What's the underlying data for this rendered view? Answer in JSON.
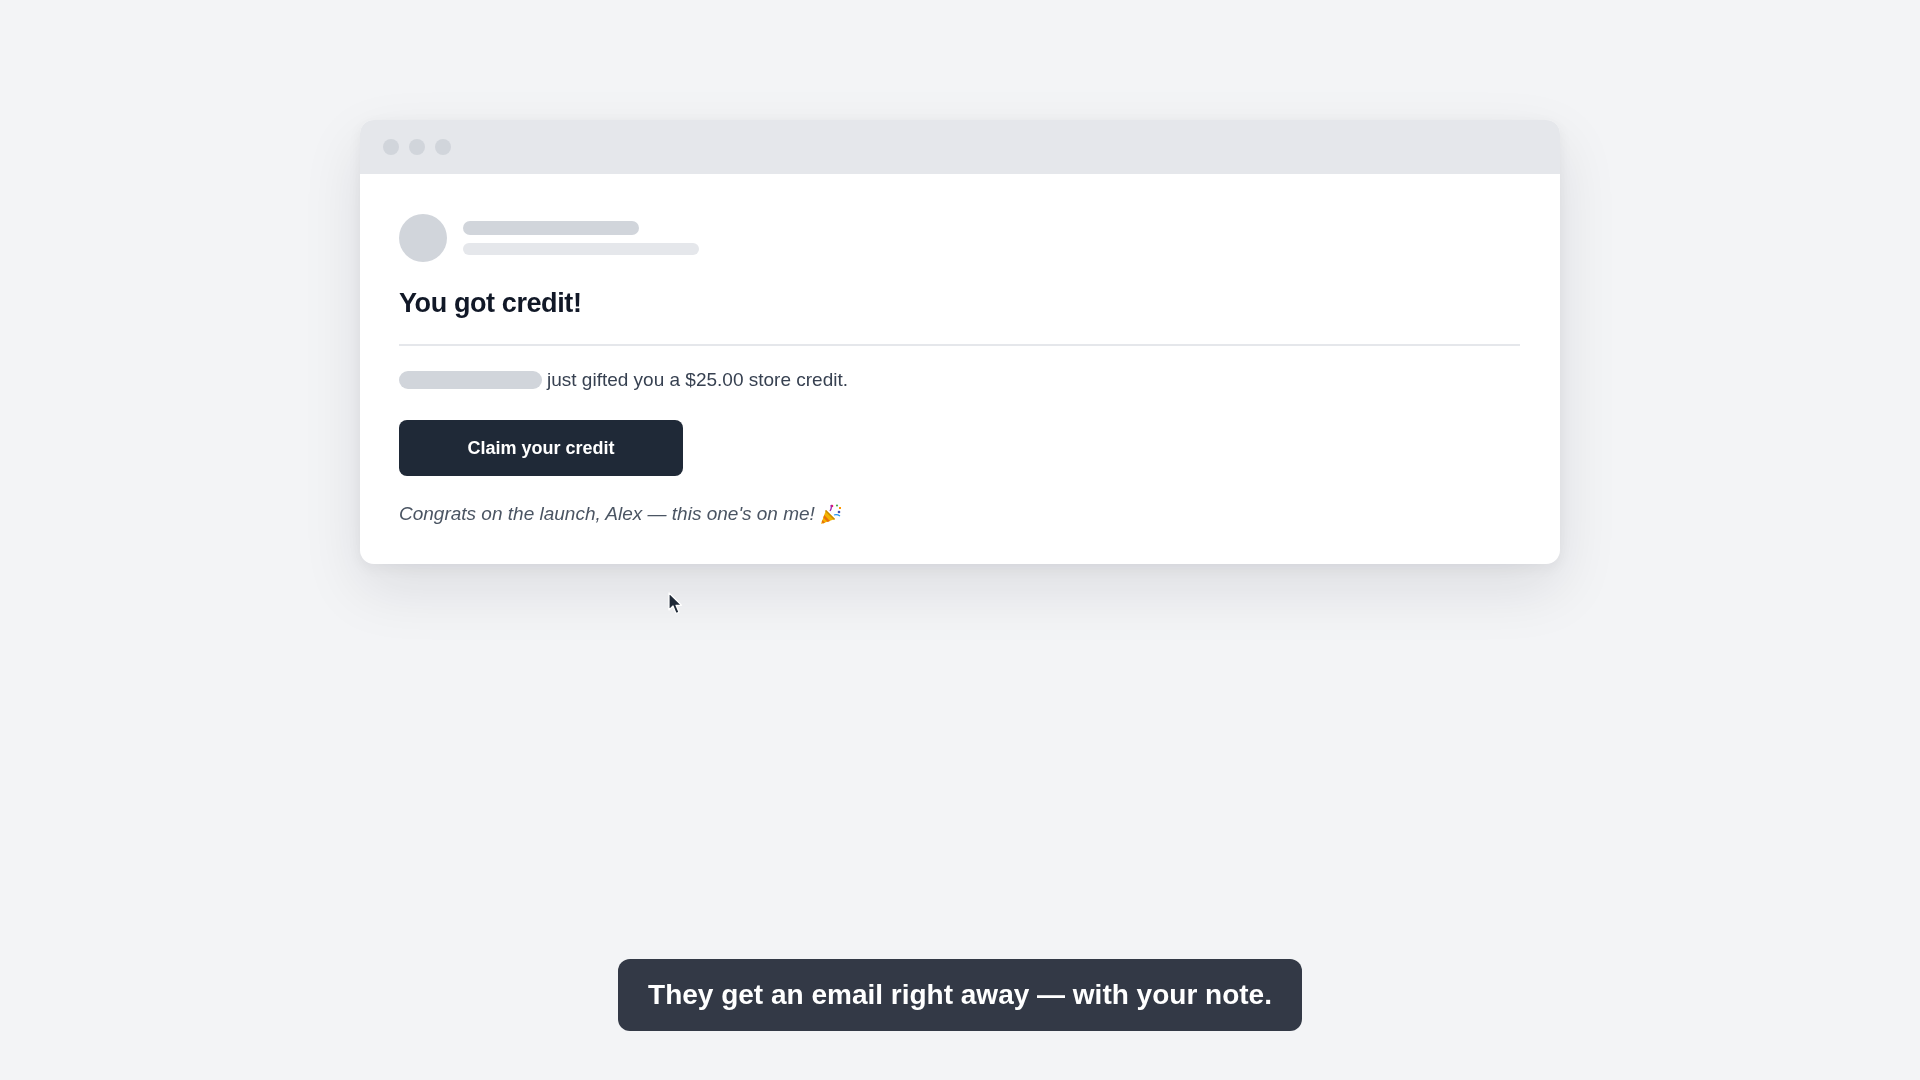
{
  "email_preview": {
    "heading": "You got credit!",
    "message": "just gifted you a $25.00 store credit.",
    "cta_button": "Claim your credit",
    "note": "Congrats on the launch, Alex — this one's on me!"
  },
  "caption": "They get an email right away — with your note."
}
